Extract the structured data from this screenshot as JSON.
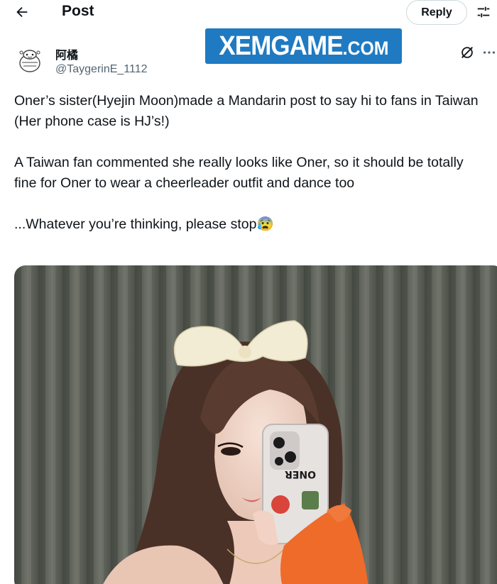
{
  "header": {
    "title": "Post",
    "reply_label": "Reply"
  },
  "author": {
    "display_name": "阿橘",
    "handle": "@TaygerinE_1112"
  },
  "watermark": {
    "main": "XEMGAME",
    "suffix": ".COM",
    "color": "#1f7ac2"
  },
  "post": {
    "line1": "Oner’s sister(Hyejin Moon)made a Mandarin post to say hi to fans in Taiwan",
    "line2": "(Her phone case is HJ’s!)",
    "line3": "A Taiwan fan commented she really looks like Oner, so it should be totally fine for Oner to wear a cheerleader outfit and dance too",
    "line4": "...Whatever you’re thinking, please stop",
    "emoji": "😰"
  },
  "phone_case_text": "ONER",
  "icons": {
    "back": "arrow-left-icon",
    "tune": "sliders-icon",
    "grok": "grok-icon",
    "more": "more-horizontal-icon"
  },
  "colors": {
    "text": "#0f1419",
    "muted": "#536471",
    "border": "#cfd9de"
  }
}
